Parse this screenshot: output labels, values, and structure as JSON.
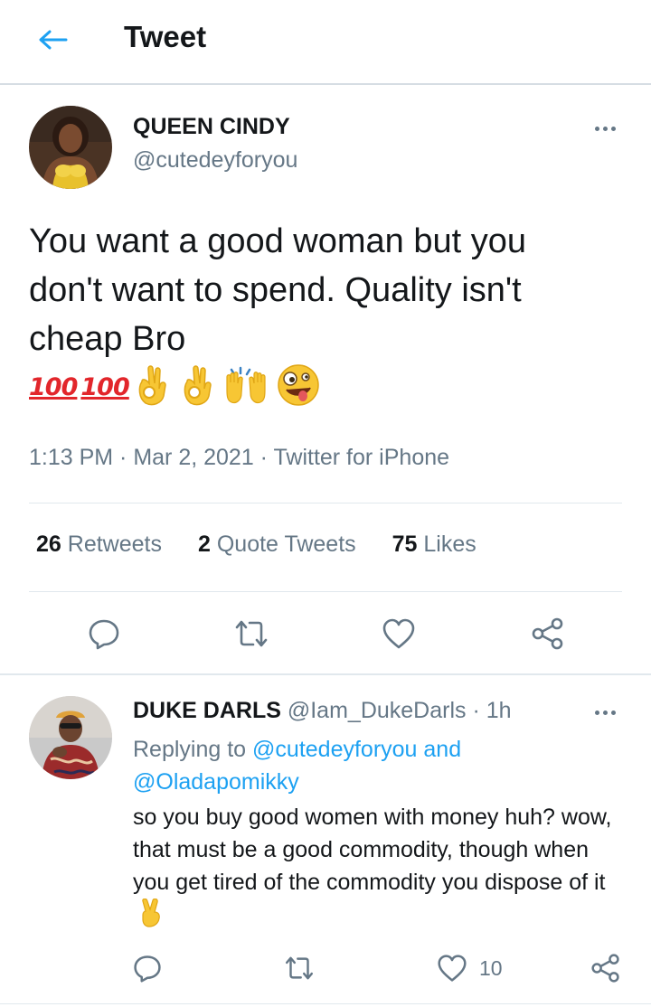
{
  "header": {
    "title": "Tweet"
  },
  "tweet": {
    "author_name": "QUEEN CINDY",
    "author_handle": "@cutedeyforyou",
    "text": "You want a good woman but you don't want to spend. Quality isn't cheap Bro",
    "emoji": [
      "100",
      "100",
      "ok-hand",
      "ok-hand",
      "raising-hands",
      "zany-face"
    ],
    "hundred_label": "100",
    "meta": "1:13 PM · Mar 2, 2021 · Twitter for iPhone",
    "stats": {
      "retweets_count": "26",
      "retweets_label": "Retweets",
      "quotes_count": "2",
      "quotes_label": "Quote Tweets",
      "likes_count": "75",
      "likes_label": "Likes"
    }
  },
  "reply": {
    "author_name": "DUKE DARLS",
    "author_handle": "@Iam_DukeDarls",
    "dot": "·",
    "time": "1h",
    "replying_prefix": "Replying to",
    "replying_user1": "@cutedeyforyou",
    "replying_and": "and",
    "replying_user2": "@Oladapomikky",
    "text": "so you buy good women with money huh? wow, that must be a good commodity, though when you get tired of the commodity you dispose of it",
    "emoji": "victory-hand",
    "likes_count": "10"
  },
  "colors": {
    "accent": "#1da1f2",
    "muted": "#657786",
    "text": "#14171a",
    "divider": "#e1e8ed"
  },
  "icons": [
    "back-arrow-icon",
    "more-icon",
    "reply-icon",
    "retweet-icon",
    "like-icon",
    "share-icon"
  ]
}
